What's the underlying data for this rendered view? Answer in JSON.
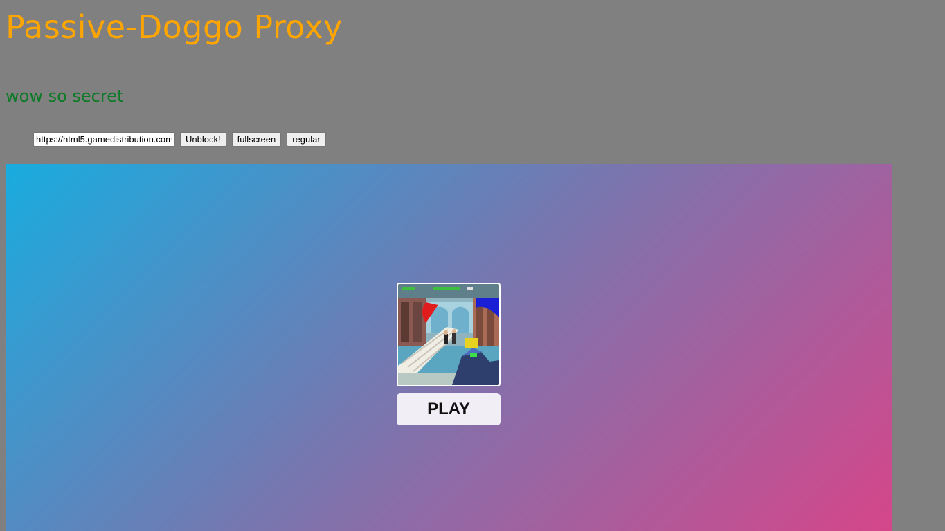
{
  "header": {
    "title": "Passive-Doggo Proxy",
    "subtitle": "wow so secret"
  },
  "controls": {
    "url_value": "https://html5.gamedistribution.com",
    "unblock_label": "Unblock!",
    "fullscreen_label": "fullscreen",
    "regular_label": "regular"
  },
  "game": {
    "thumbnail_icon": "fps-game-thumbnail",
    "play_label": "PLAY"
  },
  "colors": {
    "page_background": "#808080",
    "title": "#ffa500",
    "subtitle": "#0c7a26",
    "gradient_start": "#19acdf",
    "gradient_end": "#d5468a"
  }
}
